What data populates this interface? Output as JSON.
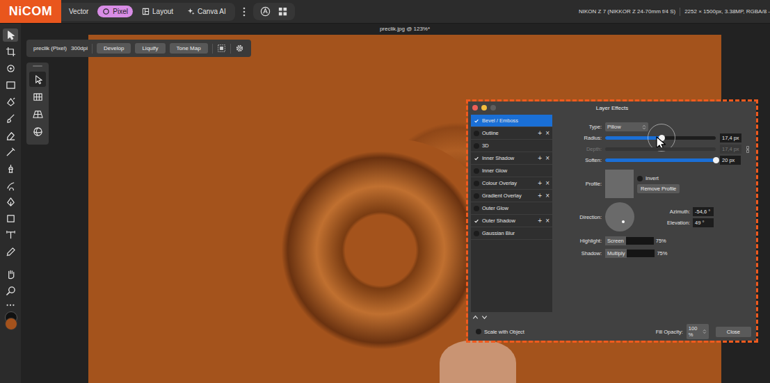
{
  "logo": {
    "text": "NiCOM"
  },
  "personas": [
    {
      "label": "Vector",
      "selected": false
    },
    {
      "label": "Pixel",
      "selected": true
    },
    {
      "label": "Layout",
      "selected": false
    },
    {
      "label": "Canva AI",
      "selected": false
    }
  ],
  "camera": "NIKON Z 7 (NIKKOR Z 24-70mm f/4 S)",
  "image_info": "2252 × 1500px, 3.38MP, RGBA/8 -",
  "tools": [
    {
      "selected": true
    },
    {
      "selected": false
    },
    {
      "selected": false
    },
    {
      "selected": false
    },
    {
      "selected": false
    },
    {
      "selected": false
    },
    {
      "selected": false
    },
    {
      "selected": false
    },
    {
      "selected": false
    },
    {
      "selected": false
    },
    {
      "selected": false
    },
    {
      "selected": false
    },
    {
      "selected": false
    },
    {
      "selected": false
    }
  ],
  "document": {
    "title": "preclik.jpg @ 123%*"
  },
  "context_toolbar": {
    "layer": "preclik (Pixel)",
    "dpi": "300dpi",
    "buttons": [
      "Develop",
      "Liquify",
      "Tone Map"
    ]
  },
  "subtools": [
    {
      "selected": true
    },
    {
      "selected": false
    },
    {
      "selected": false
    },
    {
      "selected": false
    }
  ],
  "dialog": {
    "title": "Layer Effects",
    "effects": [
      {
        "label": "Bevel / Emboss",
        "checked": true,
        "selected": true,
        "actions": []
      },
      {
        "label": "Outline",
        "checked": false,
        "selected": false,
        "actions": [
          "+",
          "×"
        ]
      },
      {
        "label": "3D",
        "checked": false,
        "selected": false,
        "actions": []
      },
      {
        "label": "Inner Shadow",
        "checked": true,
        "selected": false,
        "actions": [
          "+",
          "×"
        ]
      },
      {
        "label": "Inner Glow",
        "checked": false,
        "selected": false,
        "actions": []
      },
      {
        "label": "Colour Overlay",
        "checked": false,
        "selected": false,
        "actions": [
          "+",
          "×"
        ]
      },
      {
        "label": "Gradient Overlay",
        "checked": false,
        "selected": false,
        "actions": [
          "+",
          "×"
        ]
      },
      {
        "label": "Outer Glow",
        "checked": false,
        "selected": false,
        "actions": []
      },
      {
        "label": "Outer Shadow",
        "checked": true,
        "selected": false,
        "actions": [
          "+",
          "×"
        ]
      },
      {
        "label": "Gaussian Blur",
        "checked": false,
        "selected": false,
        "actions": []
      }
    ],
    "type": {
      "label": "Type:",
      "value": "Pillow"
    },
    "sliders": [
      {
        "label": "Radius:",
        "level": 0.51,
        "value": "17,4 px",
        "disabled": false,
        "active": true
      },
      {
        "label": "Depth:",
        "level": 0,
        "value": "17,4 px",
        "disabled": true,
        "active": false
      },
      {
        "label": "Soften:",
        "level": 1,
        "value": "20 px",
        "disabled": false,
        "active": false
      }
    ],
    "profile": {
      "label": "Profile:",
      "invert": {
        "label": "Invert",
        "checked": false
      },
      "button": "Remove Profile"
    },
    "direction": {
      "label": "Direction:",
      "azimuth": {
        "label": "Azimuth:",
        "value": "-54,6 °"
      },
      "elevation": {
        "label": "Elevation:",
        "value": "49 °"
      }
    },
    "blends": [
      {
        "label": "Highlight:",
        "mode": "Screen",
        "value": "75%"
      },
      {
        "label": "Shadow:",
        "mode": "Multiply",
        "value": "75%"
      }
    ],
    "scale_with_object": {
      "label": "Scale with Object",
      "checked": false
    },
    "fill_opacity": {
      "label": "Fill Opacity:",
      "value": "100 %"
    },
    "close": "Close"
  }
}
